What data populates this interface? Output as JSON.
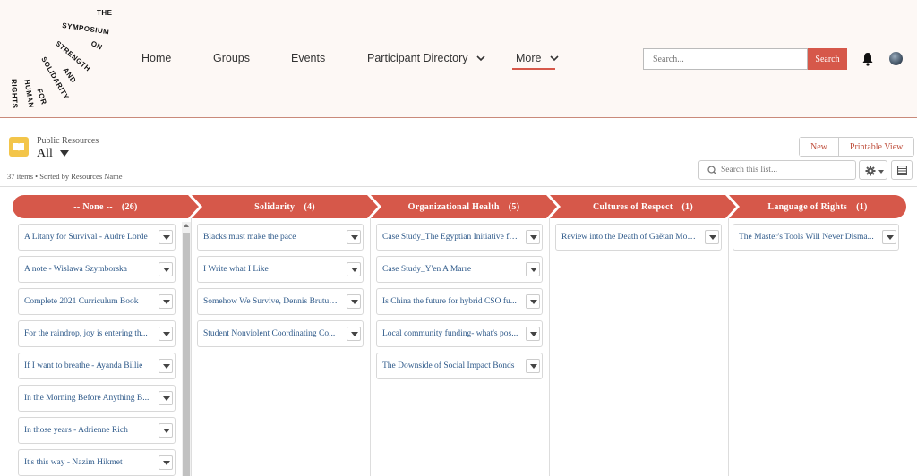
{
  "logo": {
    "words": [
      "THE",
      "SYMPOSIUM",
      "ON",
      "STRENGTH",
      "AND",
      "SOLIDARITY",
      "FOR",
      "HUMAN",
      "RIGHTS"
    ]
  },
  "nav": {
    "items": [
      "Home",
      "Groups",
      "Events",
      "Participant Directory",
      "More"
    ],
    "active": "More"
  },
  "search": {
    "placeholder": "Search...",
    "button": "Search"
  },
  "list_view": {
    "object_label": "Public Resources",
    "view_name": "All",
    "meta": "37 items • Sorted by Resources Name",
    "new_button": "New",
    "printable_button": "Printable View",
    "search_placeholder": "Search this list..."
  },
  "colors": {
    "accent": "#d6584a",
    "link": "#2f5a8a",
    "icon_bg": "#f3c54a"
  },
  "stages": [
    {
      "name": "-- None --",
      "count": "(26)"
    },
    {
      "name": "Solidarity",
      "count": "(4)"
    },
    {
      "name": "Organizational Health",
      "count": "(5)"
    },
    {
      "name": "Cultures of Respect",
      "count": "(1)"
    },
    {
      "name": "Language of Rights",
      "count": "(1)"
    }
  ],
  "columns": [
    {
      "cards": [
        "A Litany for Survival - Audre Lorde",
        "A note - Wislawa Szymborska",
        "Complete 2021 Curriculum Book",
        "For the raindrop, joy is entering th...",
        "If I want to breathe - Ayanda Billie",
        "In the Morning Before Anything B...",
        "In those years - Adrienne Rich",
        "It's this way - Nazim Hikmet"
      ]
    },
    {
      "cards": [
        "Blacks must make the pace",
        "I Write what I Like",
        "Somehow We Survive, Dennis Brutus ...",
        "Student Nonviolent Coordinating Co..."
      ]
    },
    {
      "cards": [
        "Case Study_The Egyptian Initiative fo...",
        "Case Study_Y'en A Marre",
        "Is China the future for hybrid CSO fu...",
        "Local community funding- what's pos...",
        "The Downside of Social Impact Bonds"
      ]
    },
    {
      "cards": [
        "Review into the Death of Gaëtan Moo..."
      ]
    },
    {
      "cards": [
        "The Master's Tools Will Never Disma..."
      ]
    }
  ]
}
